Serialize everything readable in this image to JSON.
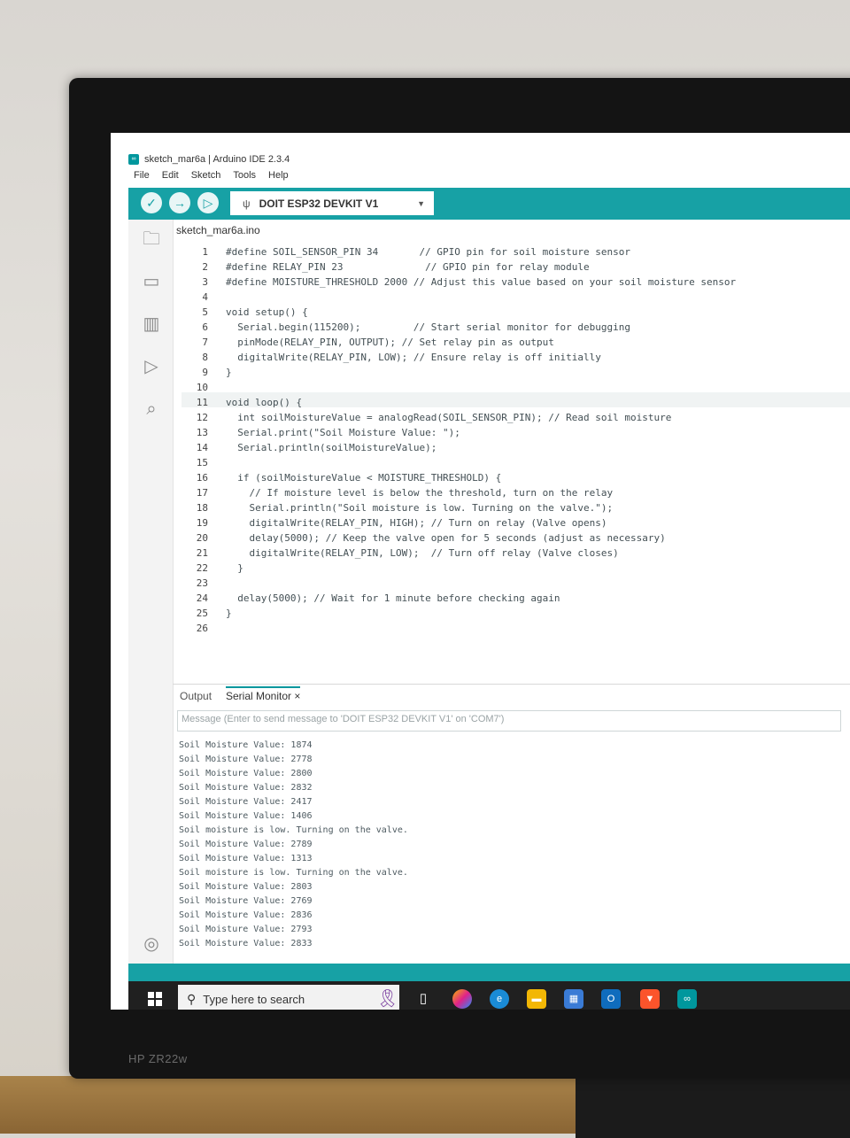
{
  "window": {
    "title": "sketch_mar6a | Arduino IDE 2.3.4"
  },
  "menu": [
    "File",
    "Edit",
    "Sketch",
    "Tools",
    "Help"
  ],
  "toolbar": {
    "board": "DOIT ESP32 DEVKIT V1"
  },
  "editor": {
    "file_tab": "sketch_mar6a.ino",
    "lines": [
      {
        "n": "1",
        "code": "#define SOIL_SENSOR_PIN 34       // GPIO pin for soil moisture sensor"
      },
      {
        "n": "2",
        "code": "#define RELAY_PIN 23              // GPIO pin for relay module"
      },
      {
        "n": "3",
        "code": "#define MOISTURE_THRESHOLD 2000 // Adjust this value based on your soil moisture sensor"
      },
      {
        "n": "4",
        "code": ""
      },
      {
        "n": "5",
        "code": "void setup() {"
      },
      {
        "n": "6",
        "code": "  Serial.begin(115200);         // Start serial monitor for debugging"
      },
      {
        "n": "7",
        "code": "  pinMode(RELAY_PIN, OUTPUT); // Set relay pin as output"
      },
      {
        "n": "8",
        "code": "  digitalWrite(RELAY_PIN, LOW); // Ensure relay is off initially"
      },
      {
        "n": "9",
        "code": "}"
      },
      {
        "n": "10",
        "code": ""
      },
      {
        "n": "11",
        "code": "void loop() {"
      },
      {
        "n": "12",
        "code": "  int soilMoistureValue = analogRead(SOIL_SENSOR_PIN); // Read soil moisture"
      },
      {
        "n": "13",
        "code": "  Serial.print(\"Soil Moisture Value: \");"
      },
      {
        "n": "14",
        "code": "  Serial.println(soilMoistureValue);"
      },
      {
        "n": "15",
        "code": ""
      },
      {
        "n": "16",
        "code": "  if (soilMoistureValue < MOISTURE_THRESHOLD) {"
      },
      {
        "n": "17",
        "code": "    // If moisture level is below the threshold, turn on the relay"
      },
      {
        "n": "18",
        "code": "    Serial.println(\"Soil moisture is low. Turning on the valve.\");"
      },
      {
        "n": "19",
        "code": "    digitalWrite(RELAY_PIN, HIGH); // Turn on relay (Valve opens)"
      },
      {
        "n": "20",
        "code": "    delay(5000); // Keep the valve open for 5 seconds (adjust as necessary)"
      },
      {
        "n": "21",
        "code": "    digitalWrite(RELAY_PIN, LOW);  // Turn off relay (Valve closes)"
      },
      {
        "n": "22",
        "code": "  }"
      },
      {
        "n": "23",
        "code": ""
      },
      {
        "n": "24",
        "code": "  delay(5000); // Wait for 1 minute before checking again"
      },
      {
        "n": "25",
        "code": "}"
      },
      {
        "n": "26",
        "code": ""
      }
    ]
  },
  "panel": {
    "tab_output": "Output",
    "tab_serial": "Serial Monitor",
    "close": "×",
    "message_placeholder": "Message (Enter to send message to 'DOIT ESP32 DEVKIT V1' on 'COM7')",
    "serial_lines": [
      "Soil Moisture Value: 1874",
      "Soil Moisture Value: 2778",
      "Soil Moisture Value: 2800",
      "Soil Moisture Value: 2832",
      "Soil Moisture Value: 2417",
      "Soil Moisture Value: 1406",
      "Soil moisture is low. Turning on the valve.",
      "Soil Moisture Value: 2789",
      "Soil Moisture Value: 1313",
      "Soil moisture is low. Turning on the valve.",
      "Soil Moisture Value: 2803",
      "Soil Moisture Value: 2769",
      "Soil Moisture Value: 2836",
      "Soil Moisture Value: 2793",
      "Soil Moisture Value: 2833"
    ]
  },
  "taskbar": {
    "search_placeholder": "Type here to search"
  },
  "monitor": {
    "brand": "HP ZR22w"
  },
  "colors": {
    "accent": "#17a1a5",
    "keyword": "#00979d",
    "function": "#d35400",
    "comment": "#95a5a6"
  }
}
